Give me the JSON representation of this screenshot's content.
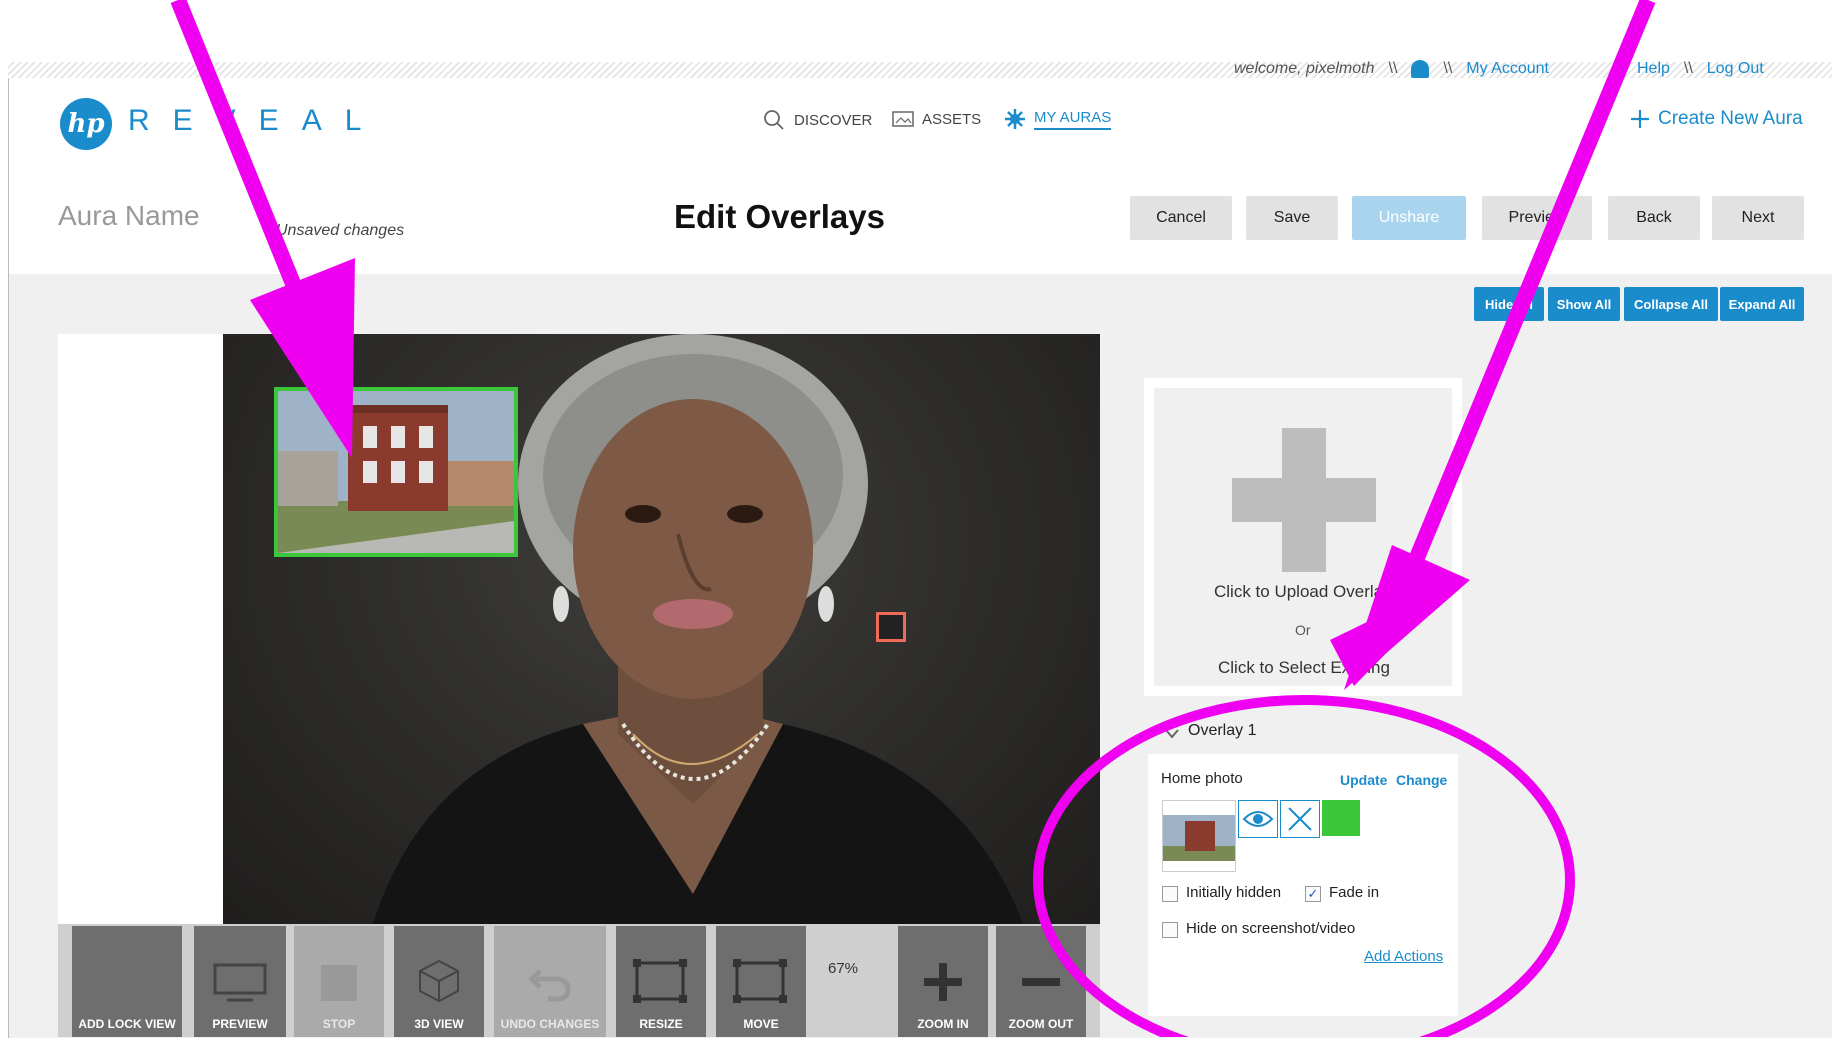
{
  "top_bar": {
    "welcome": "welcome, pixelmoth",
    "separator": "\\\\",
    "my_account": "My Account",
    "help": "Help",
    "log_out": "Log Out"
  },
  "brand": {
    "logo_mark": "hp",
    "logo_text": "REVEAL",
    "accent_color": "#1a8ccc"
  },
  "nav": {
    "discover": "DISCOVER",
    "assets": "ASSETS",
    "my_auras": "MY AURAS",
    "create_new": "Create New Aura"
  },
  "page": {
    "aura_name": "Aura Name",
    "unsaved": "Unsaved changes",
    "title": "Edit Overlays"
  },
  "actions": {
    "cancel": "Cancel",
    "save": "Save",
    "unshare": "Unshare",
    "preview": "Preview",
    "back": "Back",
    "next": "Next"
  },
  "view_controls": {
    "hide_all": "Hide All",
    "show_all": "Show All",
    "collapse_all": "Collapse All",
    "expand_all": "Expand All"
  },
  "toolbar": {
    "add_lock_view": "ADD LOCK VIEW",
    "preview": "PREVIEW",
    "stop": "STOP",
    "view_3d": "3D VIEW",
    "undo": "UNDO CHANGES",
    "resize": "RESIZE",
    "move": "MOVE",
    "zoom_level": "67%",
    "zoom_in": "ZOOM IN",
    "zoom_out": "ZOOM OUT"
  },
  "upload": {
    "line1": "Click to Upload Overlay",
    "or": "Or",
    "line2": "Click to Select Existing"
  },
  "overlay": {
    "title": "Overlay 1",
    "name": "Home photo",
    "update": "Update",
    "change": "Change",
    "initially_hidden": "Initially hidden",
    "fade_in": "Fade in",
    "hide_on_screenshot": "Hide on screenshot/video",
    "add_actions": "Add Actions",
    "color_swatch": "#3ac73a"
  },
  "annotation_color": "#f000f0"
}
